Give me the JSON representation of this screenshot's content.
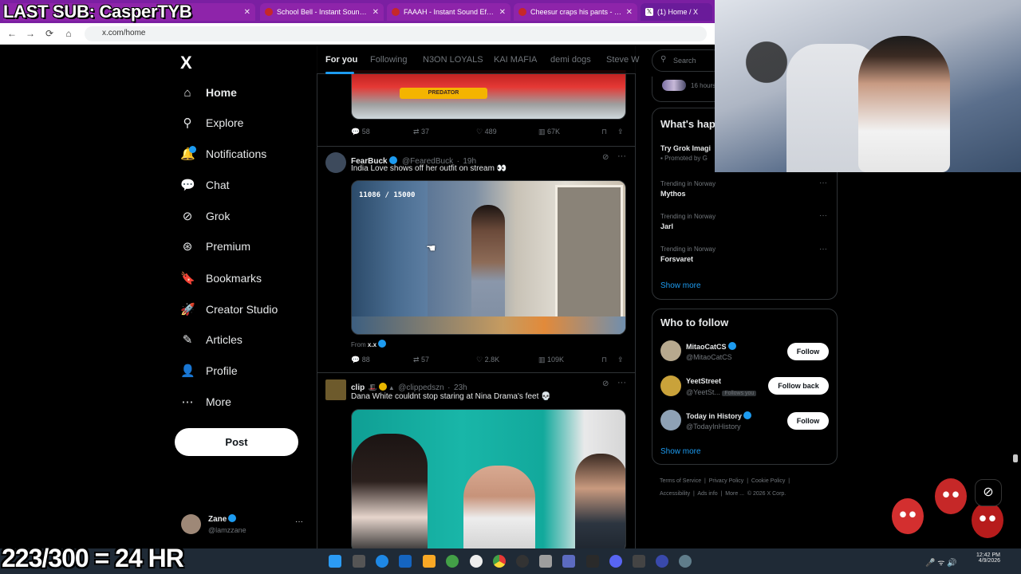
{
  "overlay": {
    "top_text": "LAST SUB: CasperTYB",
    "bottom_text": "223/300 = 24 HR"
  },
  "browser": {
    "tabs": [
      {
        "title": "School Bell - Instant Sound Effe"
      },
      {
        "title": "FAAAH - Instant Sound Effect B"
      },
      {
        "title": "Cheesur craps his pants - Insta"
      },
      {
        "title": "(1) Home / X"
      }
    ],
    "url": "x.com/home"
  },
  "sidebar": {
    "logo": "X",
    "items": [
      {
        "label": "Home",
        "icon": "home-icon",
        "glyph": "⌂"
      },
      {
        "label": "Explore",
        "icon": "search-icon",
        "glyph": "⚲"
      },
      {
        "label": "Notifications",
        "icon": "bell-icon",
        "glyph": "🔔"
      },
      {
        "label": "Chat",
        "icon": "chat-icon",
        "glyph": "💬"
      },
      {
        "label": "Grok",
        "icon": "grok-icon",
        "glyph": "⊘"
      },
      {
        "label": "Premium",
        "icon": "premium-icon",
        "glyph": "⊛"
      },
      {
        "label": "Bookmarks",
        "icon": "bookmark-icon",
        "glyph": "🔖"
      },
      {
        "label": "Creator Studio",
        "icon": "rocket-icon",
        "glyph": "🚀"
      },
      {
        "label": "Articles",
        "icon": "article-icon",
        "glyph": "✎"
      },
      {
        "label": "Profile",
        "icon": "person-icon",
        "glyph": "👤"
      },
      {
        "label": "More",
        "icon": "more-icon",
        "glyph": "⋯"
      }
    ],
    "notification_badge": "1",
    "post_label": "Post",
    "user": {
      "name": "Zane",
      "handle": "@lamzzane",
      "more": "···"
    }
  },
  "timeline": {
    "tabs": [
      "For you",
      "Following",
      "N3ON LOYALS",
      "KAI MAFIA",
      "demi dogs",
      "Steve W"
    ],
    "first_tweet_actions": {
      "replies": "58",
      "reposts": "37",
      "likes": "489",
      "views": "67K"
    },
    "first_tweet_media_label": "PREDATOR",
    "tweets": [
      {
        "name": "FearBuck",
        "handle": "@FearedBuck",
        "time": "19h",
        "text": "India Love shows off her outfit on stream 👀",
        "video_counter": "11086 / 15000",
        "from_label": "From",
        "from_user": "x.x",
        "actions": {
          "replies": "88",
          "reposts": "57",
          "likes": "2.8K",
          "views": "109K"
        }
      },
      {
        "name": "clip",
        "handle": "@clippedszn",
        "time": "23h",
        "text": "Dana White couldnt stop staring at Nina Drama's feet 💀"
      }
    ]
  },
  "right": {
    "search_placeholder": "Search",
    "top_time": "16 hours",
    "whats_happening": {
      "title": "What's hap",
      "promo": {
        "title": "Try Grok Imagi",
        "sub": "Promoted by G"
      },
      "trends": [
        {
          "context": "Trending in Norway",
          "name": "Mythos"
        },
        {
          "context": "Trending in Norway",
          "name": "Jarl"
        },
        {
          "context": "Trending in Norway",
          "name": "Forsvaret"
        }
      ],
      "show_more": "Show more"
    },
    "who_to_follow": {
      "title": "Who to follow",
      "accounts": [
        {
          "name": "MitaoCatCS",
          "handle": "@MitaoCatCS",
          "button": "Follow",
          "follows_you": ""
        },
        {
          "name": "YeetStreet",
          "handle": "@YeetSt...",
          "button": "Follow back",
          "follows_you": "Follows you"
        },
        {
          "name": "Today in History",
          "handle": "@TodayInHistory",
          "button": "Follow",
          "follows_you": ""
        }
      ],
      "show_more": "Show more"
    },
    "footer": {
      "line1": [
        "Terms of Service",
        "|",
        "Privacy Policy",
        "|",
        "Cookie Policy",
        "|"
      ],
      "line2": [
        "Accessibility",
        "|",
        "Ads info",
        "|",
        "More ...",
        "© 2026 X Corp."
      ]
    }
  },
  "taskbar": {
    "time": "12:42 PM",
    "date": "4/9/2026"
  }
}
